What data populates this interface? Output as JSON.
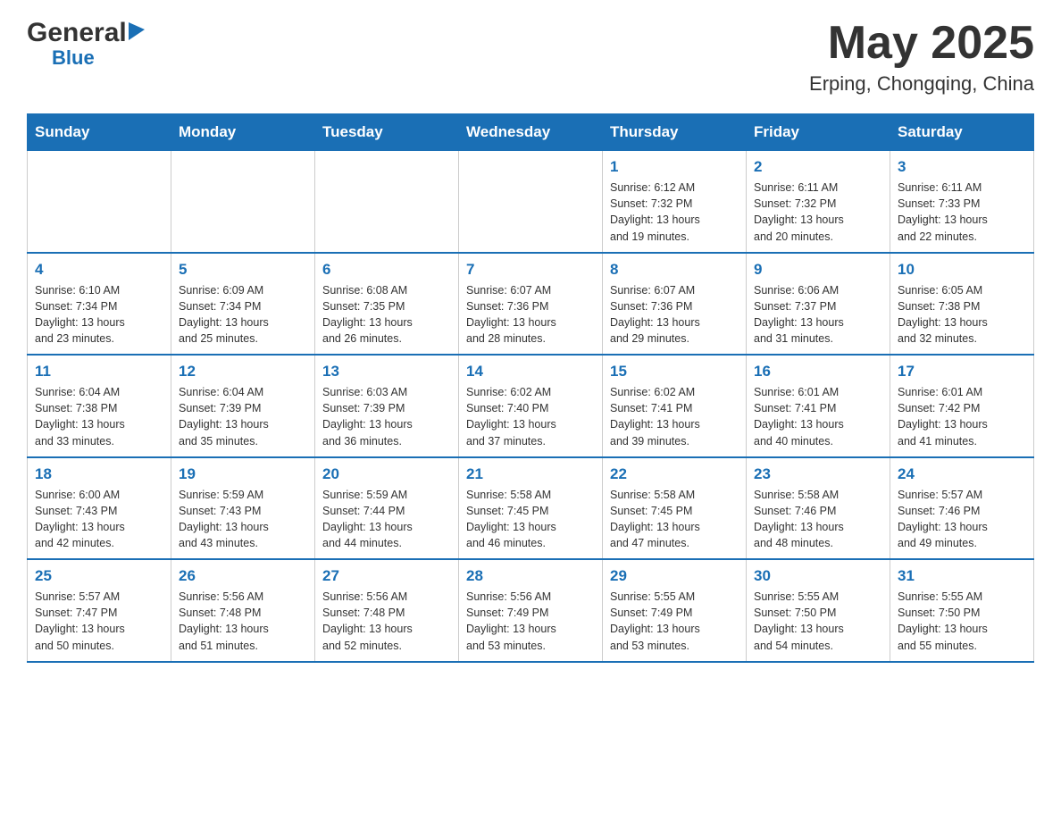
{
  "header": {
    "logo_general": "General",
    "logo_blue": "Blue",
    "title": "May 2025",
    "subtitle": "Erping, Chongqing, China"
  },
  "days_of_week": [
    "Sunday",
    "Monday",
    "Tuesday",
    "Wednesday",
    "Thursday",
    "Friday",
    "Saturday"
  ],
  "weeks": [
    [
      {
        "day": "",
        "info": ""
      },
      {
        "day": "",
        "info": ""
      },
      {
        "day": "",
        "info": ""
      },
      {
        "day": "",
        "info": ""
      },
      {
        "day": "1",
        "info": "Sunrise: 6:12 AM\nSunset: 7:32 PM\nDaylight: 13 hours\nand 19 minutes."
      },
      {
        "day": "2",
        "info": "Sunrise: 6:11 AM\nSunset: 7:32 PM\nDaylight: 13 hours\nand 20 minutes."
      },
      {
        "day": "3",
        "info": "Sunrise: 6:11 AM\nSunset: 7:33 PM\nDaylight: 13 hours\nand 22 minutes."
      }
    ],
    [
      {
        "day": "4",
        "info": "Sunrise: 6:10 AM\nSunset: 7:34 PM\nDaylight: 13 hours\nand 23 minutes."
      },
      {
        "day": "5",
        "info": "Sunrise: 6:09 AM\nSunset: 7:34 PM\nDaylight: 13 hours\nand 25 minutes."
      },
      {
        "day": "6",
        "info": "Sunrise: 6:08 AM\nSunset: 7:35 PM\nDaylight: 13 hours\nand 26 minutes."
      },
      {
        "day": "7",
        "info": "Sunrise: 6:07 AM\nSunset: 7:36 PM\nDaylight: 13 hours\nand 28 minutes."
      },
      {
        "day": "8",
        "info": "Sunrise: 6:07 AM\nSunset: 7:36 PM\nDaylight: 13 hours\nand 29 minutes."
      },
      {
        "day": "9",
        "info": "Sunrise: 6:06 AM\nSunset: 7:37 PM\nDaylight: 13 hours\nand 31 minutes."
      },
      {
        "day": "10",
        "info": "Sunrise: 6:05 AM\nSunset: 7:38 PM\nDaylight: 13 hours\nand 32 minutes."
      }
    ],
    [
      {
        "day": "11",
        "info": "Sunrise: 6:04 AM\nSunset: 7:38 PM\nDaylight: 13 hours\nand 33 minutes."
      },
      {
        "day": "12",
        "info": "Sunrise: 6:04 AM\nSunset: 7:39 PM\nDaylight: 13 hours\nand 35 minutes."
      },
      {
        "day": "13",
        "info": "Sunrise: 6:03 AM\nSunset: 7:39 PM\nDaylight: 13 hours\nand 36 minutes."
      },
      {
        "day": "14",
        "info": "Sunrise: 6:02 AM\nSunset: 7:40 PM\nDaylight: 13 hours\nand 37 minutes."
      },
      {
        "day": "15",
        "info": "Sunrise: 6:02 AM\nSunset: 7:41 PM\nDaylight: 13 hours\nand 39 minutes."
      },
      {
        "day": "16",
        "info": "Sunrise: 6:01 AM\nSunset: 7:41 PM\nDaylight: 13 hours\nand 40 minutes."
      },
      {
        "day": "17",
        "info": "Sunrise: 6:01 AM\nSunset: 7:42 PM\nDaylight: 13 hours\nand 41 minutes."
      }
    ],
    [
      {
        "day": "18",
        "info": "Sunrise: 6:00 AM\nSunset: 7:43 PM\nDaylight: 13 hours\nand 42 minutes."
      },
      {
        "day": "19",
        "info": "Sunrise: 5:59 AM\nSunset: 7:43 PM\nDaylight: 13 hours\nand 43 minutes."
      },
      {
        "day": "20",
        "info": "Sunrise: 5:59 AM\nSunset: 7:44 PM\nDaylight: 13 hours\nand 44 minutes."
      },
      {
        "day": "21",
        "info": "Sunrise: 5:58 AM\nSunset: 7:45 PM\nDaylight: 13 hours\nand 46 minutes."
      },
      {
        "day": "22",
        "info": "Sunrise: 5:58 AM\nSunset: 7:45 PM\nDaylight: 13 hours\nand 47 minutes."
      },
      {
        "day": "23",
        "info": "Sunrise: 5:58 AM\nSunset: 7:46 PM\nDaylight: 13 hours\nand 48 minutes."
      },
      {
        "day": "24",
        "info": "Sunrise: 5:57 AM\nSunset: 7:46 PM\nDaylight: 13 hours\nand 49 minutes."
      }
    ],
    [
      {
        "day": "25",
        "info": "Sunrise: 5:57 AM\nSunset: 7:47 PM\nDaylight: 13 hours\nand 50 minutes."
      },
      {
        "day": "26",
        "info": "Sunrise: 5:56 AM\nSunset: 7:48 PM\nDaylight: 13 hours\nand 51 minutes."
      },
      {
        "day": "27",
        "info": "Sunrise: 5:56 AM\nSunset: 7:48 PM\nDaylight: 13 hours\nand 52 minutes."
      },
      {
        "day": "28",
        "info": "Sunrise: 5:56 AM\nSunset: 7:49 PM\nDaylight: 13 hours\nand 53 minutes."
      },
      {
        "day": "29",
        "info": "Sunrise: 5:55 AM\nSunset: 7:49 PM\nDaylight: 13 hours\nand 53 minutes."
      },
      {
        "day": "30",
        "info": "Sunrise: 5:55 AM\nSunset: 7:50 PM\nDaylight: 13 hours\nand 54 minutes."
      },
      {
        "day": "31",
        "info": "Sunrise: 5:55 AM\nSunset: 7:50 PM\nDaylight: 13 hours\nand 55 minutes."
      }
    ]
  ]
}
